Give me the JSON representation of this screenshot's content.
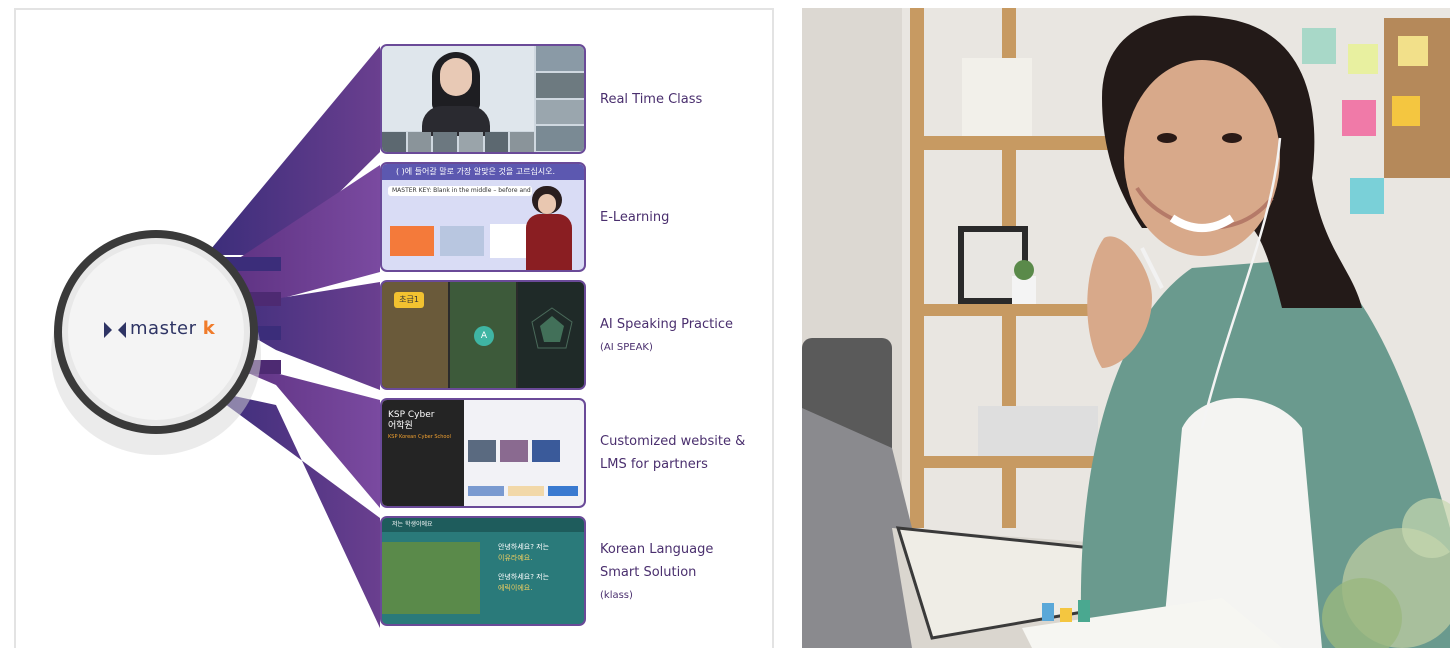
{
  "logo": {
    "text": "master",
    "accent": "k"
  },
  "features": [
    {
      "title": "Real Time Class",
      "sub": ""
    },
    {
      "title": "E-Learning",
      "sub": ""
    },
    {
      "title": "AI Speaking Practice",
      "sub": "(AI SPEAK)"
    },
    {
      "title": "Customized website &",
      "title2": "LMS for partners",
      "sub": ""
    },
    {
      "title": "Korean Language",
      "title2": "Smart Solution",
      "sub": "(klass)"
    }
  ],
  "thumbs": {
    "elearning_banner": "( )에 들어갈 말로 가장 알맞은 것을 고르십시오.",
    "elearning_key": "MASTER KEY: Blank in the middle – before and after the blank",
    "aispeak_level": "초급1",
    "aispeak_btn": "A",
    "ksp_title": "KSP Cyber",
    "ksp_sub": "어학원",
    "ksp_tag": "KSP Korean Cyber School",
    "klass_header": "저는 학생이에요",
    "klass_line1a": "안녕하세요? 저는",
    "klass_line1b": "이유라예요.",
    "klass_line2a": "안녕하세요? 저는",
    "klass_line2b": "에릭이에요."
  },
  "colors": {
    "accent": "#6a4a98",
    "text": "#4a2f6e",
    "logo": "#2e3464",
    "logo_k": "#f07b2a"
  }
}
